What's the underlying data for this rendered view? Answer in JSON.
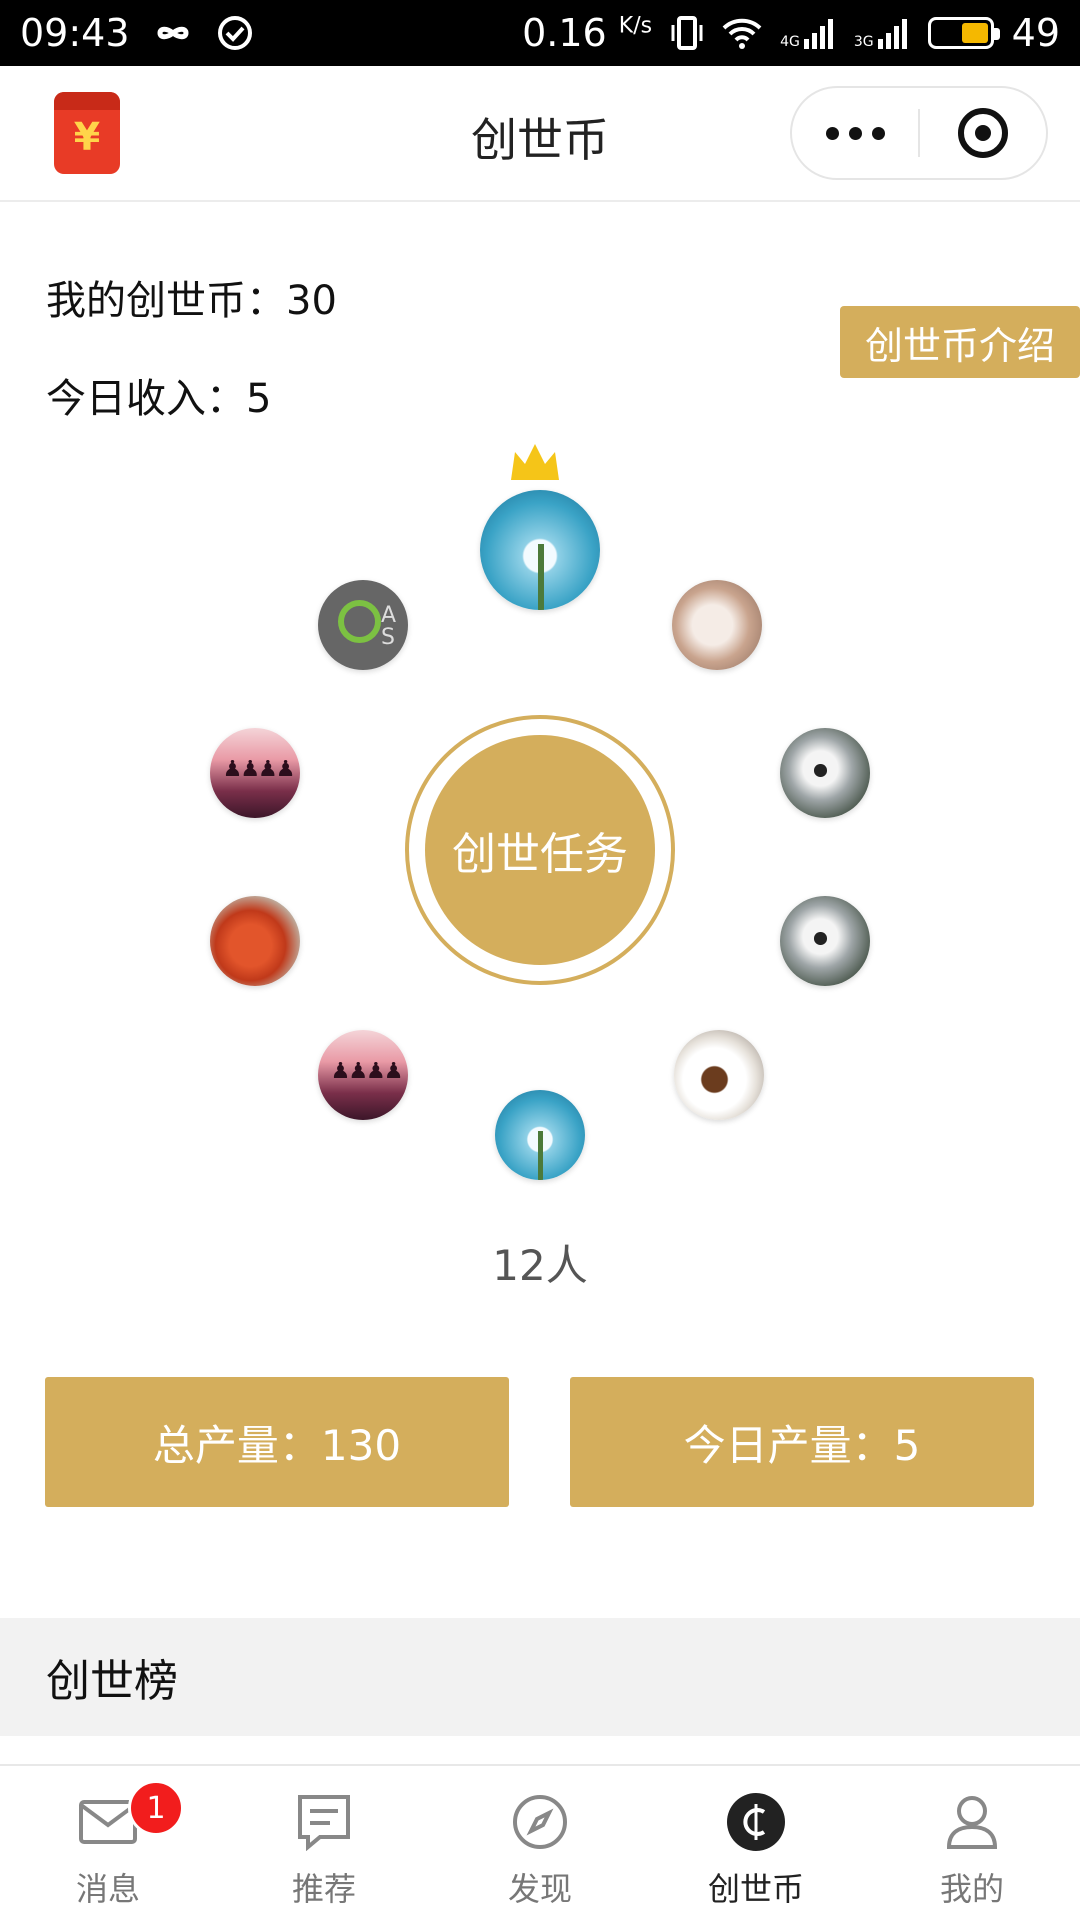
{
  "status_bar": {
    "time": "09:43",
    "speed": "0.16",
    "speed_unit": "K/s",
    "net1": "4G",
    "net2": "3G",
    "battery": "49"
  },
  "nav": {
    "title": "创世币",
    "redpacket_symbol": "¥"
  },
  "stats": {
    "my_coins": "我的创世币：30",
    "today_income": "今日收入：5",
    "intro_button": "创世币介绍"
  },
  "task": {
    "center_label": "创世任务",
    "people_count": "12人"
  },
  "avatars": [
    {
      "name": "avatar-flower-top",
      "icon": "snowdrop-flower-photo"
    },
    {
      "name": "avatar-android",
      "icon": "android-studio-logo",
      "text": "A S"
    },
    {
      "name": "avatar-rabbit",
      "icon": "rabbit-photo"
    },
    {
      "name": "avatar-people-1",
      "icon": "silhouettes-photo"
    },
    {
      "name": "avatar-cat-1",
      "icon": "cat-photo"
    },
    {
      "name": "avatar-food",
      "icon": "tomatoes-photo"
    },
    {
      "name": "avatar-cat-2",
      "icon": "cat-photo"
    },
    {
      "name": "avatar-people-2",
      "icon": "silhouettes-photo"
    },
    {
      "name": "avatar-cup",
      "icon": "coffee-cup-photo"
    },
    {
      "name": "avatar-flower-bottom",
      "icon": "snowdrop-flower-photo"
    }
  ],
  "production": {
    "total": "总产量：130",
    "today": "今日产量：5"
  },
  "ranking": {
    "title": "创世榜"
  },
  "tabs": [
    {
      "label": "消息",
      "icon": "envelope-icon",
      "badge": "1"
    },
    {
      "label": "推荐",
      "icon": "document-icon"
    },
    {
      "label": "发现",
      "icon": "compass-icon"
    },
    {
      "label": "创世币",
      "icon": "coin-icon",
      "active": true
    },
    {
      "label": "我的",
      "icon": "person-icon"
    }
  ],
  "colors": {
    "gold": "#d4ae5c",
    "badge_red": "#f21d1d",
    "redpacket": "#e83b26"
  }
}
